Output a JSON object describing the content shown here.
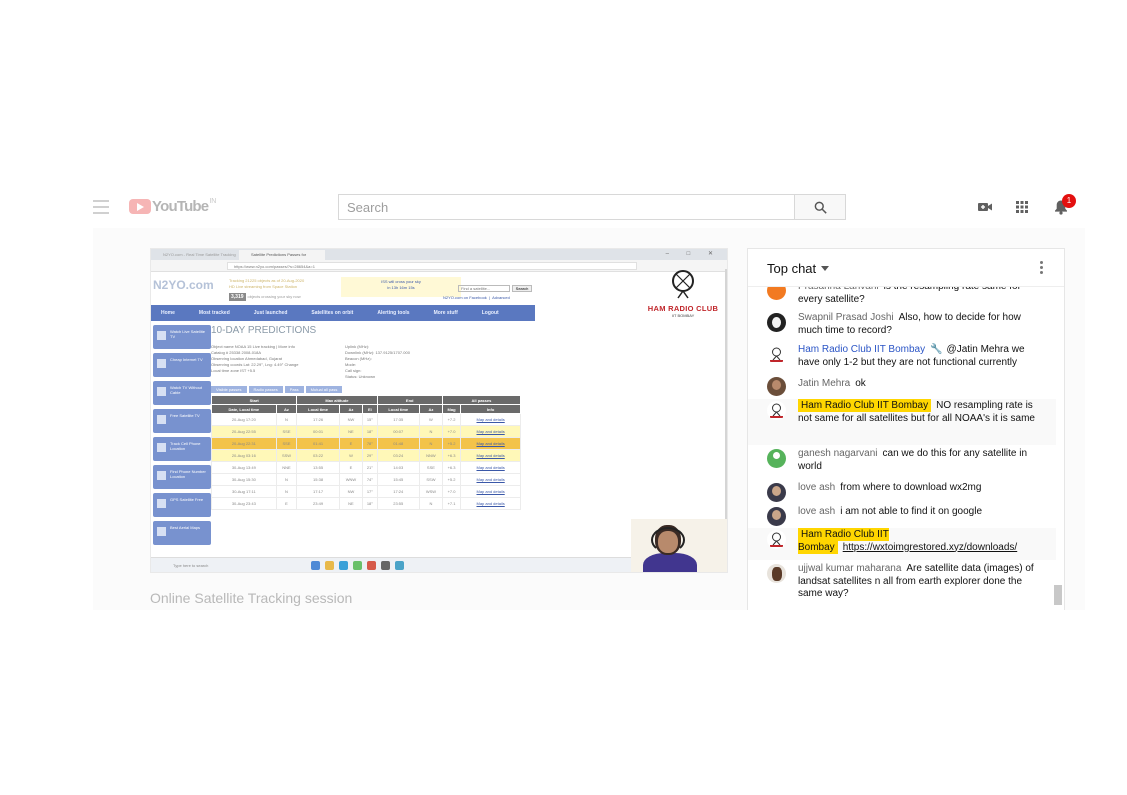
{
  "header": {
    "logo_text": "YouTube",
    "logo_region": "IN",
    "search_placeholder": "Search",
    "notification_count": "1",
    "icons": [
      "menu-icon",
      "create-video-icon",
      "apps-grid-icon",
      "bell-icon",
      "search-icon"
    ]
  },
  "video": {
    "title": "Online Satellite Tracking session",
    "browser": {
      "tab1": "N2YO.com - Real Time Satellite Tracking",
      "tab2": "Satellite Predictions Passes for",
      "url": "https://www.n2yo.com/passes/?s=28654&a=1",
      "window_controls": "– □ ✕"
    },
    "n2yo": {
      "logo": "N2YO.com",
      "tracking_line1": "Tracking 21225 objects as of 20-Aug-2020",
      "tracking_line2": "HD Live streaming from Space Station",
      "objects_count": "3,319",
      "objects_text": "objects crossing your sky now",
      "iss_line1": "ISS will cross your sky",
      "iss_line2": "in 13h 16m 15s",
      "find_placeholder": "Find a satellite...",
      "search_button": "Search",
      "facebook_link": "N2YO.com on Facebook",
      "advanced_link": "Advanced",
      "nav": [
        "Home",
        "Most tracked",
        "Just launched",
        "Satellites on orbit",
        "Alerting tools",
        "More stuff",
        "Logout"
      ],
      "sidebar": [
        "Watch Live Satellite TV",
        "Cheap Internet TV",
        "Watch TV Without Cable",
        "Free Satellite TV",
        "Track Cell Phone Location",
        "Find Phone Number Location",
        "GPS Satellite Free",
        "Best Aerial Maps"
      ],
      "page_title": "10-DAY PREDICTIONS",
      "meta": [
        "Object name   NOAA 15 Live tracking | More info",
        "Uplink (MHz):",
        "Catalog #   25338   2008-018A",
        "Downlink (MHz): 137.9125/1707.000",
        "Observing location  Ahmedabad, Gujarat",
        "Beacon (MHz):",
        "Observing coords   Lat: 22.29°, Lng: 4.49°  Change",
        "Mode:",
        "Local time zone   IST +5.5",
        "Call sign:",
        "",
        "Status: Unknown"
      ],
      "pass_tabs": [
        "Visible passes",
        "Radio passes",
        "Pass",
        "Mutual all pass"
      ],
      "table_groups": [
        "Start",
        "Max altitude",
        "End",
        "All passes"
      ],
      "table_columns": [
        "Date, Local time",
        "Az",
        "Local time",
        "Az",
        "El",
        "Local time",
        "Az",
        "Mag",
        "Info"
      ],
      "rows": [
        [
          "20-Aug 17:20",
          "N",
          "17:26",
          "NW",
          "15°",
          "17:35",
          "W",
          "+7.2",
          "Map and details"
        ],
        [
          "20-Aug 22:55",
          "SSE",
          "00:01",
          "NE",
          "18°",
          "00:07",
          "N",
          "+7.0",
          "Map and details"
        ],
        [
          "20-Aug 22:31",
          "SSE",
          "01:41",
          "E",
          "78°",
          "01:48",
          "N",
          "+5.2",
          "Map and details"
        ],
        [
          "20-Aug 03:16",
          "SSW",
          "03:22",
          "W",
          "29°",
          "03:24",
          "NNW",
          "+6.3",
          "Map and details"
        ],
        [
          "30-Aug 13:49",
          "NNE",
          "13:55",
          "E",
          "21°",
          "14:03",
          "SSE",
          "+6.3",
          "Map and details"
        ],
        [
          "30-Aug 15:30",
          "N",
          "15:38",
          "WNW",
          "74°",
          "15:45",
          "SSW",
          "+5.2",
          "Map and details"
        ],
        [
          "30-Aug 17:11",
          "N",
          "17:17",
          "NW",
          "17°",
          "17:24",
          "WSW",
          "+7.0",
          "Map and details"
        ],
        [
          "30-Aug 23:43",
          "E",
          "23:49",
          "NE",
          "18°",
          "23:55",
          "N",
          "+7.1",
          "Map and details"
        ]
      ]
    },
    "logo_overlay": {
      "name": "HAM RADIO CLUB",
      "sub": "IIT BOMBAY"
    },
    "taskbar_search": "Type here to search"
  },
  "chat": {
    "mode_label": "Top chat",
    "messages": [
      {
        "author": "Prasanna Lanvani",
        "text": "is the resampling rate same for every satellite?",
        "avatar": "orange",
        "style": "normal"
      },
      {
        "author": "Swapnil Prasad Joshi",
        "text": "Also, how to decide for how much time to record?",
        "avatar": "dark",
        "style": "normal"
      },
      {
        "author": "Ham Radio Club IIT Bombay",
        "text": "@Jatin Mehra we have only 1-2 but they are not functional currently",
        "avatar": "ham",
        "style": "owner"
      },
      {
        "author": "Jatin Mehra",
        "text": "ok",
        "avatar": "face",
        "style": "normal"
      },
      {
        "author": "Ham Radio Club IIT Bombay",
        "text": "NO resampling rate is not same for all satellites but for all NOAA's it is same",
        "avatar": "ham",
        "style": "highlight"
      },
      {
        "author": "ganesh nagarvani",
        "text": "can we do this for any satellite in world",
        "avatar": "green",
        "style": "normal"
      },
      {
        "author": "love ash",
        "text": "from where to download wx2mg",
        "avatar": "love",
        "style": "normal"
      },
      {
        "author": "love ash",
        "text": "i am not able to find it on google",
        "avatar": "love",
        "style": "normal"
      },
      {
        "author": "Ham Radio Club IIT Bombay",
        "text": "https://wxtoimgrestored.xyz/downloads/",
        "avatar": "ham",
        "style": "highlight"
      },
      {
        "author": "ujjwal kumar maharana",
        "text": "Are satellite data (images) of landsat satellites n all from earth explorer done the same way?",
        "avatar": "ujj",
        "style": "normal"
      }
    ]
  },
  "colors": {
    "youtube_red": "#e3100f",
    "owner_blue": "#2b55c6",
    "highlight_yellow": "#ffd600",
    "n2yo_nav": "#5a78c0",
    "ham_red": "#c0262b"
  }
}
